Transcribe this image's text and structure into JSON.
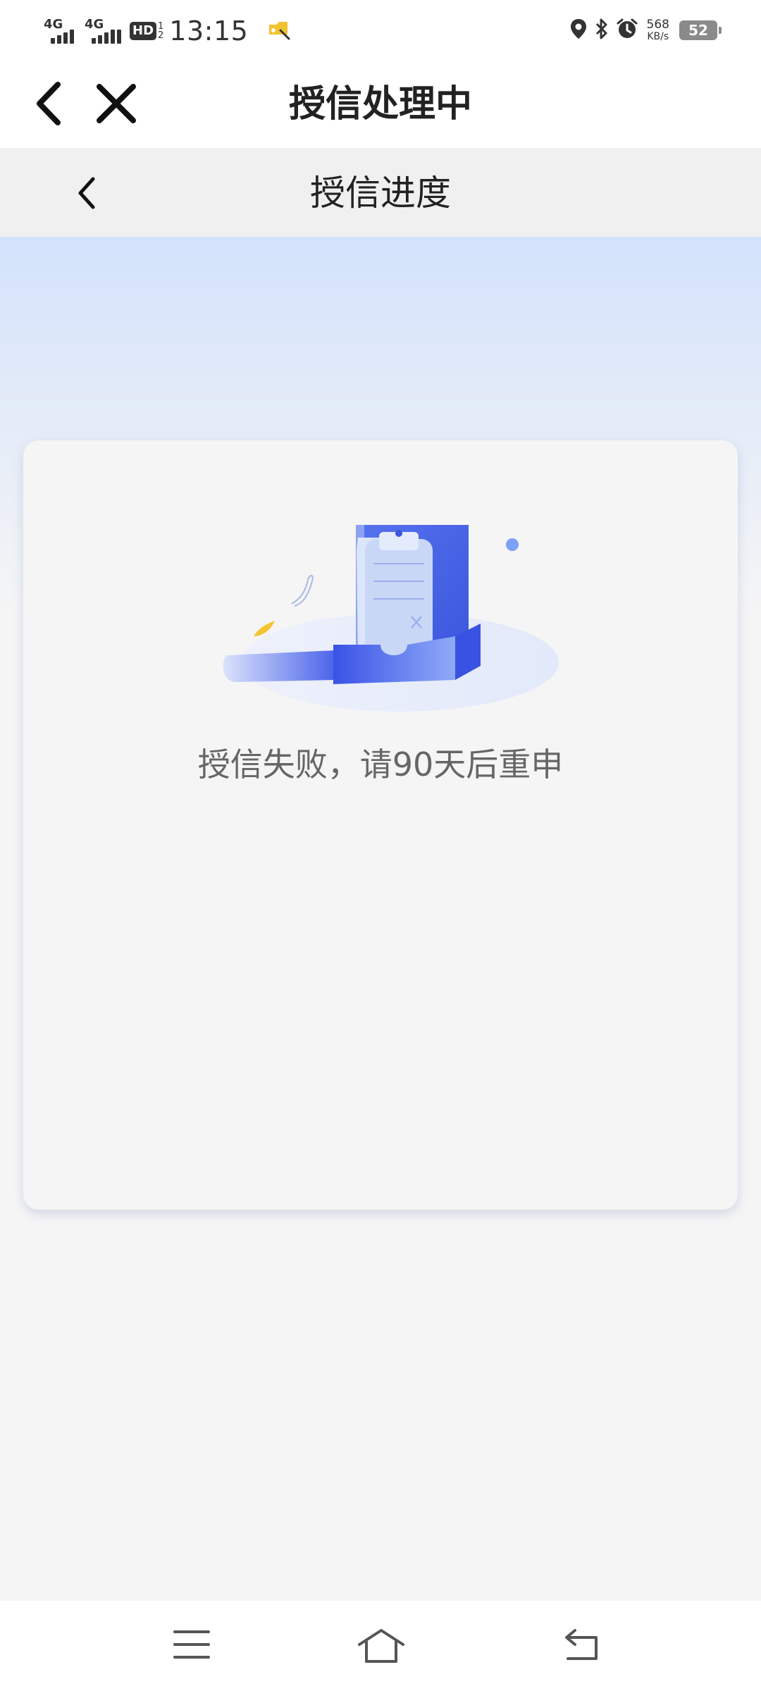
{
  "status_bar": {
    "sim1_network": "4G",
    "sim2_network": "4G",
    "hd_label": "HD",
    "hd_sim_numbers": [
      "1",
      "2"
    ],
    "time": "13:15",
    "speed_value": "568",
    "speed_unit": "KB/s",
    "battery_level": "52",
    "icons": [
      "signal-icon",
      "hd-icon",
      "app-notification-icon",
      "location-icon",
      "bluetooth-icon",
      "alarm-icon",
      "battery-icon"
    ]
  },
  "header": {
    "title": "授信处理中",
    "back_icon": "chevron-left-icon",
    "close_icon": "close-icon"
  },
  "sub_header": {
    "title": "授信进度",
    "back_icon": "chevron-left-icon"
  },
  "card": {
    "message": "授信失败，请90天后重申",
    "illustration": "document-in-tray-rejected-illustration"
  },
  "nav_bar": {
    "icons": [
      "menu-icon",
      "home-icon",
      "back-icon"
    ]
  },
  "colors": {
    "accent": "#4a6cf0",
    "gradient_top": "#d3e2fb",
    "background": "#f5f5f5",
    "title_text": "#222222",
    "message_text": "#666666"
  }
}
